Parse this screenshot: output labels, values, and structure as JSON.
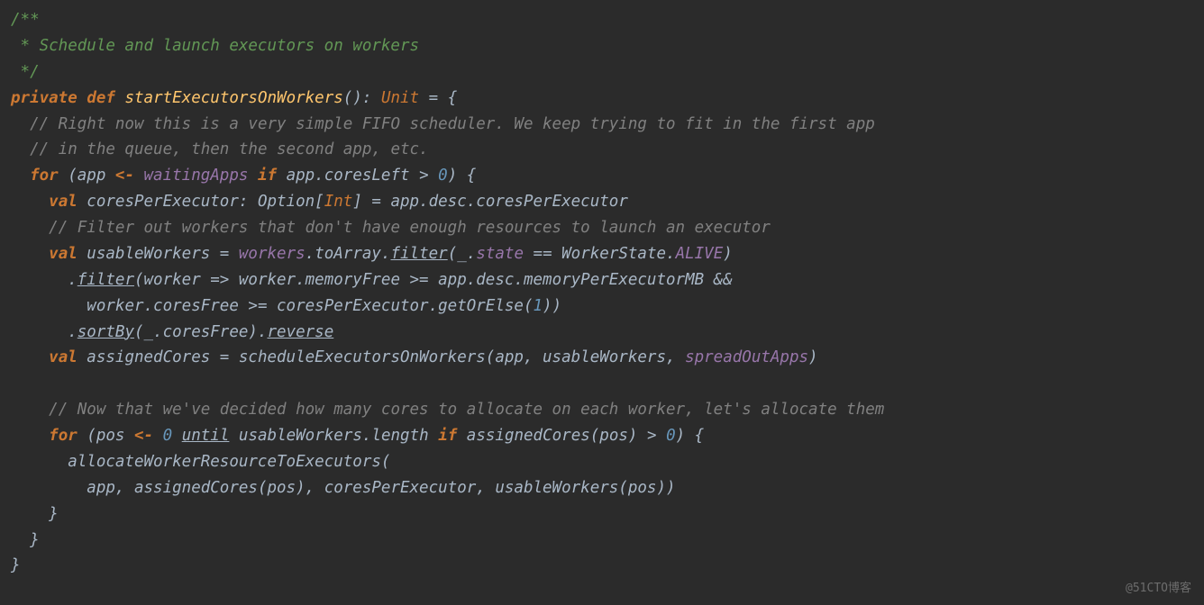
{
  "code": {
    "doc1": "/**",
    "doc2": " * Schedule and launch executors on workers",
    "doc3": " */",
    "kw_private": "private",
    "kw_def": "def",
    "fn_name": "startExecutorsOnWorkers",
    "parens_unit": "(): ",
    "type_unit": "Unit",
    "eq_brace": " = {",
    "cm1": "// Right now this is a very simple FIFO scheduler. We keep trying to fit in the first app",
    "cm2": "// in the queue, then the second app, etc.",
    "kw_for1": "for",
    "for1_open": " (app ",
    "arrow1": "<-",
    "waitingApps": " waitingApps",
    "kw_if1": " if",
    "for1_cond": " app.coresLeft > ",
    "zero1": "0",
    "for1_close": ") {",
    "kw_val1": "val",
    "val1_name": " coresPerExecutor: Option[",
    "type_int": "Int",
    "val1_rest": "] = app.desc.coresPerExecutor",
    "cm3": "// Filter out workers that don't have enough resources to launch an executor",
    "kw_val2": "val",
    "val2_name": " usableWorkers = ",
    "workers_it": "workers",
    "toArray": ".toArray.",
    "filter1": "filter",
    "filter1_open": "(_.",
    "state_it": "state",
    "filter1_eq": " == WorkerState.",
    "alive_it": "ALIVE",
    "filter1_close": ")",
    "dot_filter2": ".",
    "filter2": "filter",
    "filter2_body": "(worker => worker.memoryFree >= app.desc.memoryPerExecutorMB &&",
    "filter2_line2": "worker.coresFree >= coresPerExecutor.getOrElse(",
    "one": "1",
    "filter2_close": "))",
    "dot_sortby": ".",
    "sortBy": "sortBy",
    "sortby_body": "(_.coresFree).",
    "reverse": "reverse",
    "kw_val3": "val",
    "val3_body": " assignedCores = scheduleExecutorsOnWorkers(app, usableWorkers, ",
    "spreadOut": "spreadOutApps",
    "val3_close": ")",
    "cm4": "// Now that we've decided how many cores to allocate on each worker, let's allocate them",
    "kw_for2": "for",
    "for2_open": " (pos ",
    "arrow2": "<-",
    "sp_zero": " ",
    "zero2": "0",
    "sp_until": " ",
    "until": "until",
    "for2_mid": " usableWorkers.length ",
    "kw_if2": "if",
    "for2_cond": " assignedCores(pos) > ",
    "zero3": "0",
    "for2_close": ") {",
    "alloc_call": "allocateWorkerResourceToExecutors(",
    "alloc_args": "app, assignedCores(pos), coresPerExecutor, usableWorkers(pos))",
    "brace_c1": "}",
    "brace_c2": "}",
    "brace_c3": "}",
    "watermark": "@51CTO博客"
  }
}
